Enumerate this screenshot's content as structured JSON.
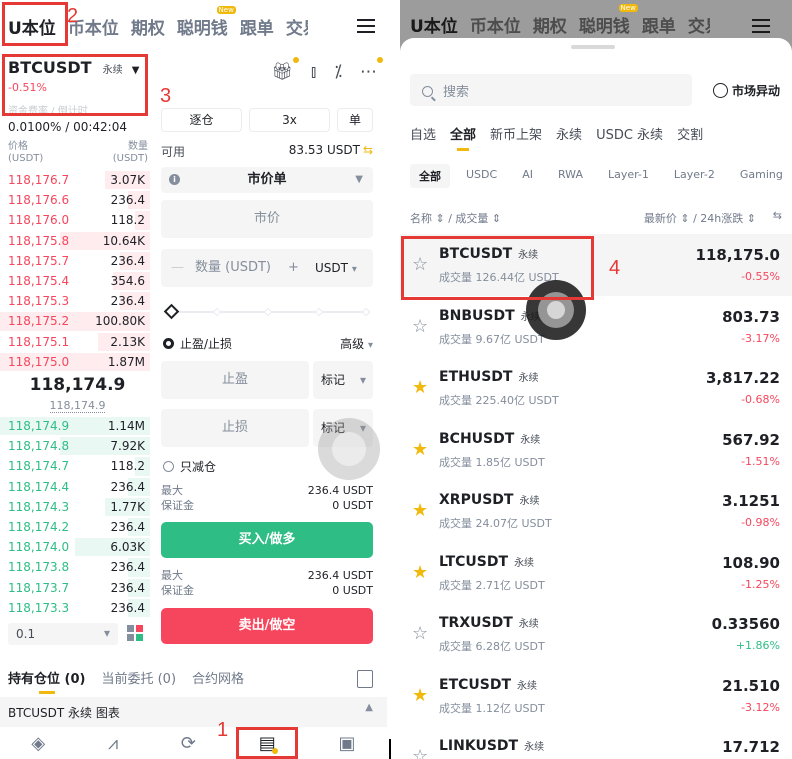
{
  "left": {
    "nav_tabs": [
      "U本位",
      "币本位",
      "期权",
      "聪明钱",
      "跟单",
      "交易"
    ],
    "new_badge": "New",
    "symbol": "BTCUSDT",
    "contract_type": "永续",
    "change_pct": "-0.51%",
    "funding_label": "资金费率 / 倒计时",
    "funding_value": "0.0100% / 00:42:04",
    "ob_header": {
      "price": "价格",
      "price_unit": "(USDT)",
      "qty": "数量",
      "qty_unit": "(USDT)"
    },
    "asks": [
      {
        "price": "118,176.7",
        "qty": "3.07K",
        "depth": 0.3
      },
      {
        "price": "118,176.6",
        "qty": "236.4",
        "depth": 0.15
      },
      {
        "price": "118,176.0",
        "qty": "118.2",
        "depth": 0.1
      },
      {
        "price": "118,175.8",
        "qty": "10.64K",
        "depth": 0.6
      },
      {
        "price": "118,175.7",
        "qty": "236.4",
        "depth": 0.2
      },
      {
        "price": "118,175.4",
        "qty": "354.6",
        "depth": 0.25
      },
      {
        "price": "118,175.3",
        "qty": "236.4",
        "depth": 0.2
      },
      {
        "price": "118,175.2",
        "qty": "100.80K",
        "depth": 1.0
      },
      {
        "price": "118,175.1",
        "qty": "2.13K",
        "depth": 0.35
      },
      {
        "price": "118,175.0",
        "qty": "1.87M",
        "depth": 1.0
      }
    ],
    "last_price": "118,174.9",
    "mark_price": "118,174.9",
    "bids": [
      {
        "price": "118,174.9",
        "qty": "1.14M",
        "depth": 1.0
      },
      {
        "price": "118,174.8",
        "qty": "7.92K",
        "depth": 0.6
      },
      {
        "price": "118,174.7",
        "qty": "118.2",
        "depth": 0.1
      },
      {
        "price": "118,174.4",
        "qty": "236.4",
        "depth": 0.15
      },
      {
        "price": "118,174.3",
        "qty": "1.77K",
        "depth": 0.3
      },
      {
        "price": "118,174.2",
        "qty": "236.4",
        "depth": 0.15
      },
      {
        "price": "118,174.0",
        "qty": "6.03K",
        "depth": 0.5
      },
      {
        "price": "118,173.8",
        "qty": "236.4",
        "depth": 0.15
      },
      {
        "price": "118,173.7",
        "qty": "236.4",
        "depth": 0.15
      },
      {
        "price": "118,173.3",
        "qty": "236.4",
        "depth": 0.15
      }
    ],
    "depth_step": "0.1",
    "margin_mode": "逐仓",
    "leverage": "3x",
    "position_mode": "单",
    "available_label": "可用",
    "available_value": "83.53 USDT",
    "order_type": "市价单",
    "price_placeholder": "市价",
    "qty_placeholder": "数量 (USDT)",
    "qty_unit": "USDT",
    "tpsl_label": "止盈/止损",
    "advanced_label": "高级",
    "tp_placeholder": "止盈",
    "sl_placeholder": "止损",
    "trigger_type": "标记",
    "reduce_only": "只减仓",
    "max_label": "最大",
    "margin_label": "保证金",
    "buy_max": "236.4 USDT",
    "buy_margin": "0 USDT",
    "buy_button": "买入/做多",
    "sell_max": "236.4 USDT",
    "sell_margin": "0 USDT",
    "sell_button": "卖出/做空",
    "bottom_tabs": [
      "持有仓位 (0)",
      "当前委托 (0)",
      "合约网格"
    ],
    "sub_bar": "BTCUSDT 永续  图表",
    "colors": {
      "buy": "#2ebd85",
      "sell": "#f6465d",
      "accent": "#f0b90b"
    }
  },
  "right": {
    "nav_tabs": [
      "U本位",
      "币本位",
      "期权",
      "聪明钱",
      "跟单",
      "交易"
    ],
    "new_badge": "New",
    "search_placeholder": "搜索",
    "market_moves": "市场异动",
    "categories": [
      "自选",
      "全部",
      "新币上架",
      "永续",
      "USDC 永续",
      "交割"
    ],
    "chips": [
      "全部",
      "USDC",
      "AI",
      "RWA",
      "Layer-1",
      "Layer-2",
      "Gaming"
    ],
    "col_left": "名称 ⇕ / 成交量 ⇕",
    "col_right": "最新价 ⇕ / 24h涨跌 ⇕",
    "rows": [
      {
        "symbol": "BTCUSDT",
        "type": "永续",
        "volume": "成交量 126.44亿 USDT",
        "price": "118,175.0",
        "change": "-0.55%",
        "fav": false,
        "up": false
      },
      {
        "symbol": "BNBUSDT",
        "type": "永续",
        "volume": "成交量 9.67亿 USDT",
        "price": "803.73",
        "change": "-3.17%",
        "fav": false,
        "up": false
      },
      {
        "symbol": "ETHUSDT",
        "type": "永续",
        "volume": "成交量 225.40亿 USDT",
        "price": "3,817.22",
        "change": "-0.68%",
        "fav": true,
        "up": false
      },
      {
        "symbol": "BCHUSDT",
        "type": "永续",
        "volume": "成交量 1.85亿 USDT",
        "price": "567.92",
        "change": "-1.51%",
        "fav": true,
        "up": false
      },
      {
        "symbol": "XRPUSDT",
        "type": "永续",
        "volume": "成交量 24.07亿 USDT",
        "price": "3.1251",
        "change": "-0.98%",
        "fav": true,
        "up": false
      },
      {
        "symbol": "LTCUSDT",
        "type": "永续",
        "volume": "成交量 2.71亿 USDT",
        "price": "108.90",
        "change": "-1.25%",
        "fav": true,
        "up": false
      },
      {
        "symbol": "TRXUSDT",
        "type": "永续",
        "volume": "成交量 6.28亿 USDT",
        "price": "0.33560",
        "change": "+1.86%",
        "fav": false,
        "up": true
      },
      {
        "symbol": "ETCUSDT",
        "type": "永续",
        "volume": "成交量 1.12亿 USDT",
        "price": "21.510",
        "change": "-3.12%",
        "fav": true,
        "up": false
      },
      {
        "symbol": "LINKUSDT",
        "type": "永续",
        "volume": "",
        "price": "17.712",
        "change": "",
        "fav": false,
        "up": false
      }
    ]
  },
  "annotations": [
    "1",
    "2",
    "3",
    "4"
  ]
}
